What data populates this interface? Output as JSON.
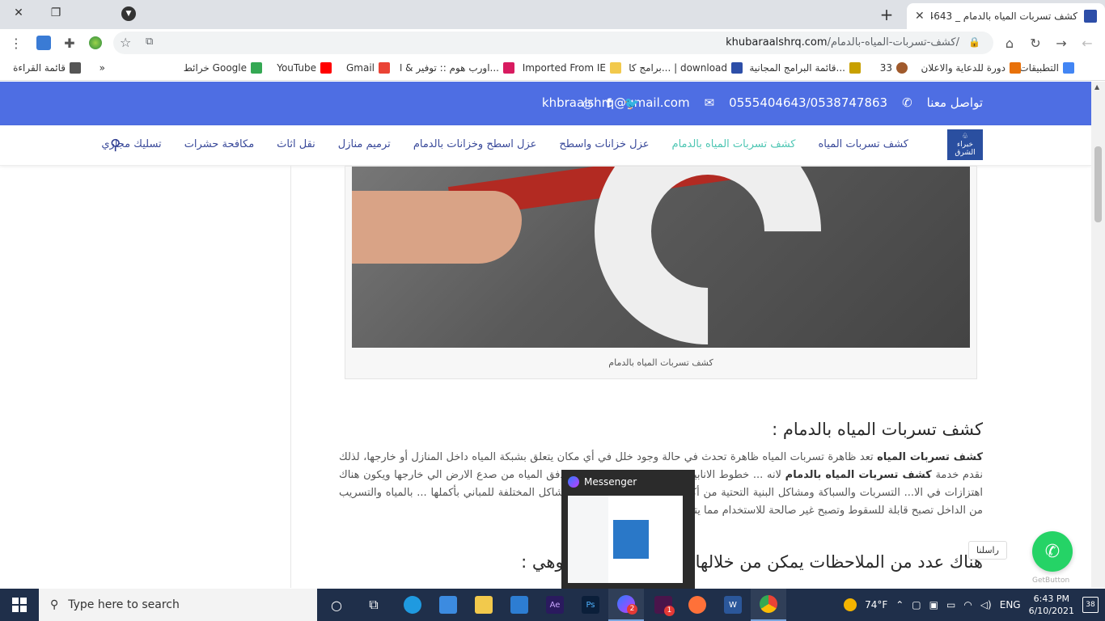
{
  "browser": {
    "tab_title": "كشف تسربات المياه بالدمام _ 4643",
    "tab_close": "✕",
    "new_tab": "+",
    "url_host": "khubaraalshrq.com",
    "url_path": "/كشف-تسربات-المياه-بالدمام/",
    "window_min": "—",
    "window_restore": "❐",
    "window_close": "✕"
  },
  "bookmarks": [
    {
      "label": "التطبيقات",
      "color": "#4285f4"
    },
    {
      "label": "دورة للدعاية والاعلان",
      "color": "#e8710a"
    },
    {
      "label": "33",
      "color": "#a05a2c"
    },
    {
      "label": "قائمة البرامج المجانية...",
      "color": "#c8a000"
    },
    {
      "label": "برامج كا... | download",
      "color": "#2d4ea8"
    },
    {
      "label": "Imported From IE",
      "color": "#f2c94c"
    },
    {
      "label": "اورب هوم :: توفير & ا...",
      "color": "#d81b60"
    },
    {
      "label": "Gmail",
      "color": "#ea4335"
    },
    {
      "label": "YouTube",
      "color": "#ff0000"
    },
    {
      "label": "خرائط Google",
      "color": "#34a853"
    },
    {
      "label": "»",
      "color": ""
    },
    {
      "label": "قائمة القراءة",
      "color": "#555555"
    }
  ],
  "site": {
    "contact_label": "تواصل معنا",
    "phones": "0555404643/0538747863",
    "email": "khbraalshrq@gmail.com",
    "logo_text": "خبراء الشرق",
    "nav": [
      {
        "label": "كشف تسربات المياه",
        "active": false
      },
      {
        "label": "كشف تسربات المياه بالدمام",
        "active": true
      },
      {
        "label": "عزل خزانات واسطح",
        "active": false
      },
      {
        "label": "عزل اسطح وخزانات بالدمام",
        "active": false
      },
      {
        "label": "ترميم منازل",
        "active": false
      },
      {
        "label": "نقل اثاث",
        "active": false
      },
      {
        "label": "مكافحة حشرات",
        "active": false
      },
      {
        "label": "تسليك مجاري",
        "active": false
      }
    ],
    "figure_caption": "كشف تسربات المياه بالدمام",
    "heading": "كشف تسربات المياه بالدمام :",
    "para_bold1": "كشف تسربات المياه",
    "para_text1": " تعد ظاهرة تسربات المياه ظاهرة تحدث في حالة وجود خلل في أي مكان يتعلق بشبكة المياه داخل المنازل أو خارجها، لذلك نقدم خدمة ",
    "para_bold2": "كشف تسربات المياه بالدمام",
    "para_text2": " لانه ... خطوط الانابيب وضغط الماء عليها تسبب تدفق المياه من صدع الارض الي خارجها ويكون هناك اهتزازات في الا... التسربات والسباكة ومشاكل البنية التحتية من أكثر ما يسبب لنا العديد من المشاكل المختلفة للمباني بأكملها ... بالمياه والتسريب من الداخل تصبح قابلة للسقوط وتصبح غير صالحة للاستخدام مما يتسبب في التعرض ... عام.",
    "heading2": "هناك عدد من الملاحظات يمكن من خلالها ... تسربات المياه وهي :",
    "wa_label": "راسلنا",
    "getbutton": "GetButton"
  },
  "preview": {
    "title": "Messenger"
  },
  "taskbar": {
    "search_placeholder": "Type here to search",
    "weather": "74°F",
    "lang": "ENG",
    "time": "6:43 PM",
    "date": "6/10/2021",
    "notif_count": "38",
    "viber_badge": "2",
    "slack_badge": "1"
  }
}
